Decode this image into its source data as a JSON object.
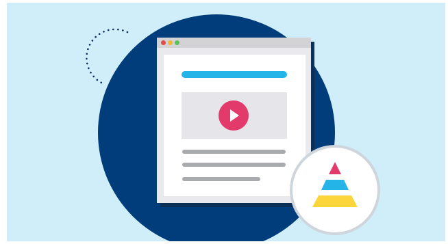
{
  "illustration": {
    "colors": {
      "background": "#cfeefa",
      "circle": "#003d7a",
      "accent_blue": "#25b4e8",
      "play_red": "#e13a6b",
      "pyramid_top": "#e13a6b",
      "pyramid_middle": "#25b4e8",
      "pyramid_bottom": "#fcd43b"
    },
    "icons": [
      "browser-window",
      "play-icon",
      "pyramid-icon",
      "dotted-arc"
    ]
  }
}
